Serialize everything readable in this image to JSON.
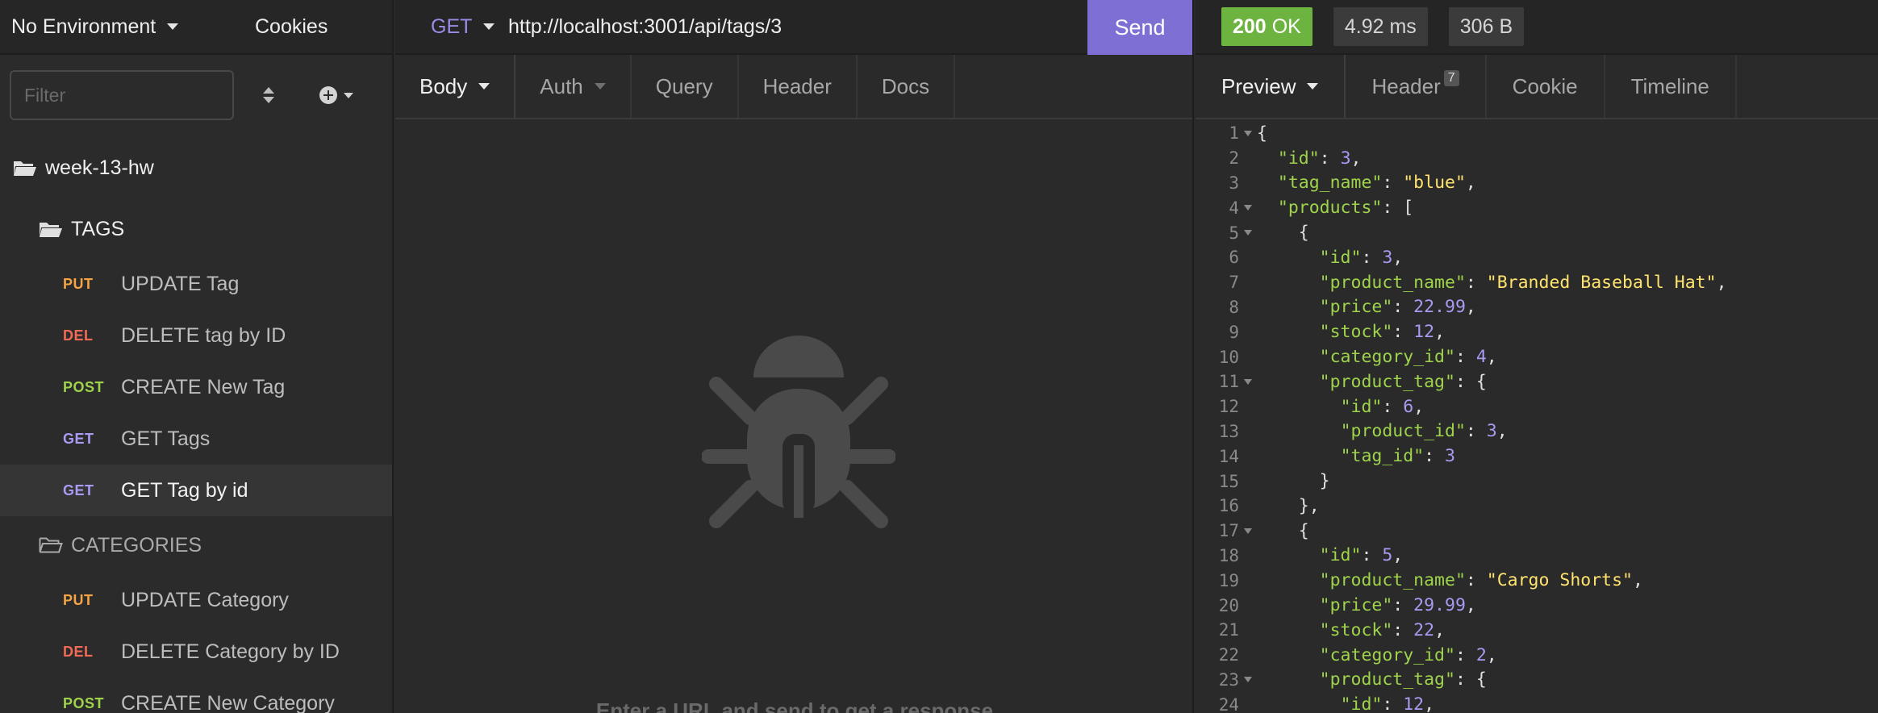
{
  "sidebar": {
    "environment": "No Environment",
    "cookies": "Cookies",
    "filter_placeholder": "Filter",
    "workspace": "week-13-hw",
    "folders": [
      {
        "name": "TAGS",
        "requests": [
          {
            "method": "PUT",
            "name": "UPDATE Tag"
          },
          {
            "method": "DEL",
            "name": "DELETE tag by ID"
          },
          {
            "method": "POST",
            "name": "CREATE New Tag"
          },
          {
            "method": "GET",
            "name": "GET Tags"
          },
          {
            "method": "GET",
            "name": "GET Tag by id"
          }
        ]
      },
      {
        "name": "CATEGORIES",
        "requests": [
          {
            "method": "PUT",
            "name": "UPDATE Category"
          },
          {
            "method": "DEL",
            "name": "DELETE Category by ID"
          },
          {
            "method": "POST",
            "name": "CREATE New Category"
          }
        ]
      }
    ]
  },
  "request": {
    "method": "GET",
    "url": "http://localhost:3001/api/tags/3",
    "send_label": "Send",
    "tabs": [
      "Body",
      "Auth",
      "Query",
      "Header",
      "Docs"
    ],
    "empty_hint": "Enter a URL and send to get a response"
  },
  "response": {
    "status_code": "200",
    "status_text": "OK",
    "time": "4.92 ms",
    "size": "306 B",
    "tabs": [
      "Preview",
      "Header",
      "Cookie",
      "Timeline"
    ],
    "header_count": "7"
  },
  "colors": {
    "accent": "#7e6fd4",
    "status_ok": "#6cb33f",
    "put": "#f5a343",
    "del": "#f26a55",
    "post": "#9ed34b",
    "get": "#a99af2"
  }
}
